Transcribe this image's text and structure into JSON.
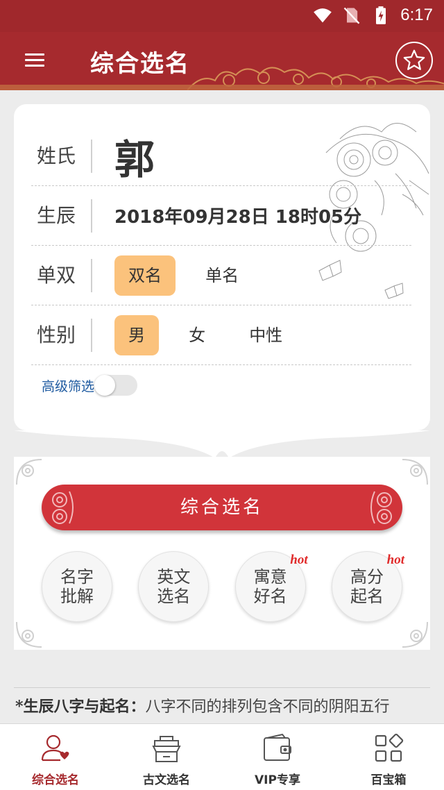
{
  "status_bar": {
    "time": "6:17",
    "icons": [
      "wifi-icon",
      "no-sim-icon",
      "battery-charging-icon"
    ]
  },
  "app_bar": {
    "title": "综合选名",
    "menu_icon": "menu-icon",
    "favorite_icon": "star-icon"
  },
  "form": {
    "surname": {
      "label": "姓氏",
      "value": "郭"
    },
    "birth": {
      "label": "生辰",
      "value": "2018年09月28日 18时05分"
    },
    "name_length": {
      "label": "单双",
      "options": [
        "双名",
        "单名"
      ],
      "selected": "双名"
    },
    "gender": {
      "label": "性别",
      "options": [
        "男",
        "女",
        "中性"
      ],
      "selected": "男"
    },
    "advanced_filter": {
      "label": "高级筛选",
      "enabled": false
    }
  },
  "actions": {
    "main_button": "综合选名",
    "circles": [
      {
        "line1": "名字",
        "line2": "批解",
        "badge": ""
      },
      {
        "line1": "英文",
        "line2": "选名",
        "badge": ""
      },
      {
        "line1": "寓意",
        "line2": "好名",
        "badge": "hot"
      },
      {
        "line1": "高分",
        "line2": "起名",
        "badge": "hot"
      }
    ]
  },
  "info": {
    "heading": "*生辰八字与起名：",
    "text": "八字不同的排列包含不同的阴阳五行"
  },
  "bottom_nav": [
    {
      "label": "综合选名",
      "icon": "person-heart-icon",
      "active": true
    },
    {
      "label": "古文选名",
      "icon": "book-stack-icon",
      "active": false
    },
    {
      "label": "VIP专享",
      "icon": "wallet-icon",
      "active": false
    },
    {
      "label": "百宝箱",
      "icon": "grid-icon",
      "active": false
    }
  ],
  "colors": {
    "primary": "#a62a2e",
    "accent": "#d1343a",
    "chip_active": "#fbc27c",
    "link": "#1e5aa0"
  }
}
